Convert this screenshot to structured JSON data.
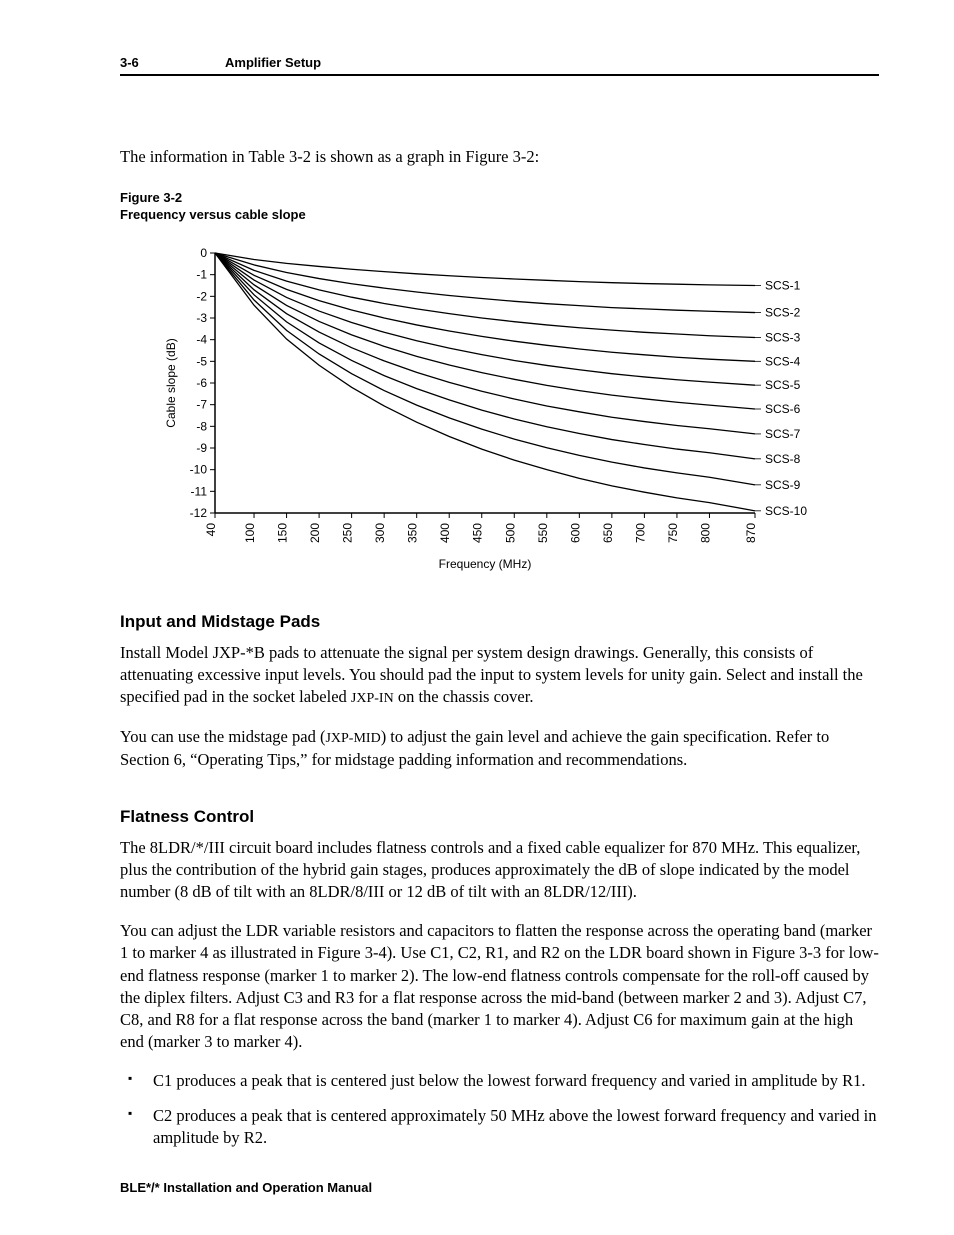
{
  "header": {
    "page_number": "3-6",
    "section": "Amplifier Setup"
  },
  "intro": "The information in Table 3-2 is shown as a graph in Figure 3-2:",
  "figure_label": {
    "number": "Figure 3-2",
    "caption": "Frequency versus cable slope"
  },
  "chart_data": {
    "type": "line",
    "xlabel": "Frequency (MHz)",
    "ylabel": "Cable slope (dB)",
    "xlim": [
      40,
      870
    ],
    "ylim": [
      -12,
      0
    ],
    "x_ticks": [
      40,
      100,
      150,
      200,
      250,
      300,
      350,
      400,
      450,
      500,
      550,
      600,
      650,
      700,
      750,
      800,
      870
    ],
    "y_ticks": [
      0,
      -1,
      -2,
      -3,
      -4,
      -5,
      -6,
      -7,
      -8,
      -9,
      -10,
      -11,
      -12
    ],
    "x": [
      40,
      100,
      150,
      200,
      250,
      300,
      350,
      400,
      450,
      500,
      550,
      600,
      650,
      700,
      750,
      800,
      870
    ],
    "series": [
      {
        "name": "SCS-1",
        "values": [
          0,
          -0.3,
          -0.48,
          -0.62,
          -0.75,
          -0.86,
          -0.96,
          -1.05,
          -1.13,
          -1.2,
          -1.26,
          -1.32,
          -1.37,
          -1.41,
          -1.44,
          -1.47,
          -1.5
        ]
      },
      {
        "name": "SCS-2",
        "values": [
          0,
          -0.55,
          -0.9,
          -1.18,
          -1.42,
          -1.62,
          -1.8,
          -1.96,
          -2.1,
          -2.23,
          -2.34,
          -2.43,
          -2.52,
          -2.58,
          -2.64,
          -2.69,
          -2.75
        ]
      },
      {
        "name": "SCS-3",
        "values": [
          0,
          -0.8,
          -1.3,
          -1.7,
          -2.04,
          -2.33,
          -2.58,
          -2.8,
          -3.0,
          -3.17,
          -3.32,
          -3.45,
          -3.56,
          -3.66,
          -3.74,
          -3.82,
          -3.9
        ]
      },
      {
        "name": "SCS-4",
        "values": [
          0,
          -1.03,
          -1.68,
          -2.2,
          -2.63,
          -3.0,
          -3.32,
          -3.6,
          -3.85,
          -4.07,
          -4.26,
          -4.43,
          -4.58,
          -4.7,
          -4.81,
          -4.9,
          -5.0
        ]
      },
      {
        "name": "SCS-5",
        "values": [
          0,
          -1.25,
          -2.05,
          -2.68,
          -3.21,
          -3.66,
          -4.05,
          -4.39,
          -4.69,
          -4.96,
          -5.19,
          -5.39,
          -5.57,
          -5.72,
          -5.85,
          -5.96,
          -6.1
        ]
      },
      {
        "name": "SCS-6",
        "values": [
          0,
          -1.47,
          -2.42,
          -3.16,
          -3.78,
          -4.31,
          -4.77,
          -5.17,
          -5.52,
          -5.83,
          -6.11,
          -6.35,
          -6.56,
          -6.73,
          -6.89,
          -7.02,
          -7.2
        ]
      },
      {
        "name": "SCS-7",
        "values": [
          0,
          -1.7,
          -2.8,
          -3.65,
          -4.37,
          -4.98,
          -5.51,
          -5.97,
          -6.38,
          -6.74,
          -7.06,
          -7.33,
          -7.58,
          -7.78,
          -7.96,
          -8.11,
          -8.35
        ]
      },
      {
        "name": "SCS-8",
        "values": [
          0,
          -1.93,
          -3.18,
          -4.15,
          -4.96,
          -5.66,
          -6.26,
          -6.78,
          -7.25,
          -7.66,
          -8.02,
          -8.33,
          -8.61,
          -8.84,
          -9.05,
          -9.22,
          -9.5
        ]
      },
      {
        "name": "SCS-9",
        "values": [
          0,
          -2.17,
          -3.57,
          -4.66,
          -5.57,
          -6.35,
          -7.02,
          -7.61,
          -8.13,
          -8.59,
          -8.99,
          -9.34,
          -9.65,
          -9.92,
          -10.15,
          -10.35,
          -10.7
        ]
      },
      {
        "name": "SCS-10",
        "values": [
          0,
          -2.41,
          -3.97,
          -5.18,
          -6.2,
          -7.06,
          -7.81,
          -8.47,
          -9.05,
          -9.56,
          -10.0,
          -10.4,
          -10.75,
          -11.04,
          -11.3,
          -11.52,
          -11.9
        ]
      }
    ]
  },
  "sections": {
    "input_pads": {
      "title": "Input and Midstage Pads",
      "p1_pre": "Install Model JXP-*B pads to attenuate the signal per system design drawings. Generally, this consists of attenuating excessive input levels. You should pad the input to system levels for unity gain. Select and install the specified pad in the socket labeled ",
      "p1_sc": "JXP-IN",
      "p1_post": " on the chassis cover.",
      "p2_pre": "You can use the midstage pad (",
      "p2_sc": "JXP-MID",
      "p2_post": ") to adjust the gain level and achieve the gain specification. Refer to Section 6, “Operating Tips,” for midstage padding information and recommendations."
    },
    "flatness": {
      "title": "Flatness Control",
      "p1": "The 8LDR/*/III circuit board includes flatness controls and a fixed cable equalizer for 870 MHz. This equalizer, plus the contribution of the hybrid gain stages, produces approximately the dB of slope indicated by the model number (8 dB of tilt with an 8LDR/8/III or 12 dB of tilt with an 8LDR/12/III).",
      "p2": "You can adjust the LDR variable resistors and capacitors to flatten the response across the operating band (marker 1 to marker 4 as illustrated in Figure 3-4). Use C1, C2, R1, and R2 on the LDR board shown in Figure 3-3 for low-end flatness response (marker 1 to marker 2). The low-end flatness controls compensate for the roll-off caused by the diplex filters. Adjust C3 and R3 for a flat response across the mid-band (between marker 2 and 3). Adjust C7, C8, and R8 for a flat response across the band (marker 1 to marker 4). Adjust C6 for maximum gain at the high end (marker 3 to marker 4).",
      "bullets": [
        "C1 produces a peak that is centered just below the lowest forward frequency and varied in amplitude by R1.",
        "C2 produces a peak that is centered approximately 50 MHz above the lowest forward frequency and varied in amplitude by R2."
      ]
    }
  },
  "footer": "BLE*/* Installation and Operation Manual"
}
